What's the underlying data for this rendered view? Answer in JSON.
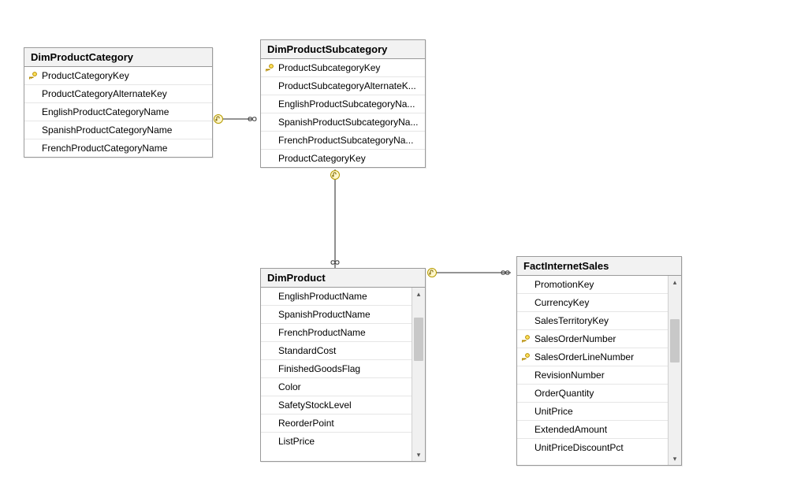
{
  "tables": {
    "dimProductCategory": {
      "title": "DimProductCategory",
      "columns": [
        {
          "name": "ProductCategoryKey",
          "pk": true
        },
        {
          "name": "ProductCategoryAlternateKey",
          "pk": false
        },
        {
          "name": "EnglishProductCategoryName",
          "pk": false
        },
        {
          "name": "SpanishProductCategoryName",
          "pk": false
        },
        {
          "name": "FrenchProductCategoryName",
          "pk": false
        }
      ]
    },
    "dimProductSubcategory": {
      "title": "DimProductSubcategory",
      "columns": [
        {
          "name": "ProductSubcategoryKey",
          "pk": true
        },
        {
          "name": "ProductSubcategoryAlternateK...",
          "pk": false
        },
        {
          "name": "EnglishProductSubcategoryNa...",
          "pk": false
        },
        {
          "name": "SpanishProductSubcategoryNa...",
          "pk": false
        },
        {
          "name": "FrenchProductSubcategoryNa...",
          "pk": false
        },
        {
          "name": "ProductCategoryKey",
          "pk": false
        }
      ]
    },
    "dimProduct": {
      "title": "DimProduct",
      "columns": [
        {
          "name": "EnglishProductName",
          "pk": false
        },
        {
          "name": "SpanishProductName",
          "pk": false
        },
        {
          "name": "FrenchProductName",
          "pk": false
        },
        {
          "name": "StandardCost",
          "pk": false
        },
        {
          "name": "FinishedGoodsFlag",
          "pk": false
        },
        {
          "name": "Color",
          "pk": false
        },
        {
          "name": "SafetyStockLevel",
          "pk": false
        },
        {
          "name": "ReorderPoint",
          "pk": false
        },
        {
          "name": "ListPrice",
          "pk": false
        }
      ]
    },
    "factInternetSales": {
      "title": "FactInternetSales",
      "columns": [
        {
          "name": "PromotionKey",
          "pk": false
        },
        {
          "name": "CurrencyKey",
          "pk": false
        },
        {
          "name": "SalesTerritoryKey",
          "pk": false
        },
        {
          "name": "SalesOrderNumber",
          "pk": true
        },
        {
          "name": "SalesOrderLineNumber",
          "pk": true
        },
        {
          "name": "RevisionNumber",
          "pk": false
        },
        {
          "name": "OrderQuantity",
          "pk": false
        },
        {
          "name": "UnitPrice",
          "pk": false
        },
        {
          "name": "ExtendedAmount",
          "pk": false
        },
        {
          "name": "UnitPriceDiscountPct",
          "pk": false
        }
      ]
    }
  },
  "relationships": [
    {
      "from": "DimProductCategory",
      "to": "DimProductSubcategory",
      "type": "one-to-many"
    },
    {
      "from": "DimProductSubcategory",
      "to": "DimProduct",
      "type": "one-to-many"
    },
    {
      "from": "DimProduct",
      "to": "FactInternetSales",
      "type": "one-to-many"
    }
  ],
  "glyphs": {
    "up": "▴",
    "down": "▾"
  }
}
